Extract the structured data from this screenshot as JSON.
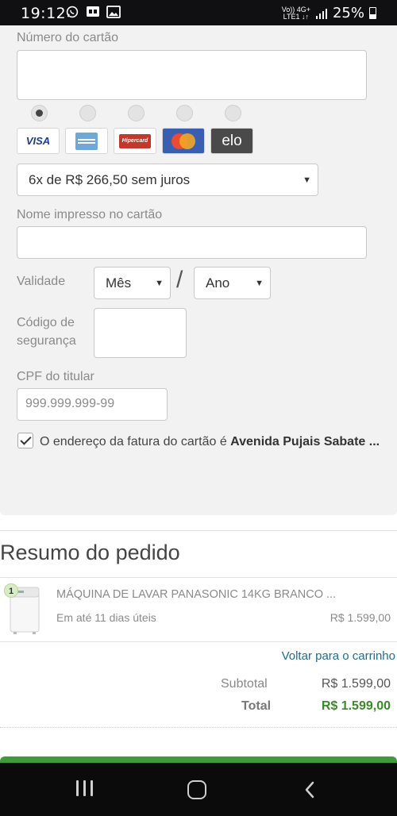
{
  "status_bar": {
    "time": "19:12",
    "network_top": "Vo)) 4G+",
    "network_bottom": "LTE1 ↓↑",
    "battery": "25%",
    "icons": [
      "whatsapp-icon",
      "gallery-icon",
      "image-icon",
      "signal-icon",
      "battery-icon"
    ]
  },
  "form": {
    "card_number_label": "Número do cartão",
    "card_number_value": "",
    "card_brands": [
      "VISA",
      "American Express",
      "Hipercard",
      "MasterCard",
      "elo"
    ],
    "selected_brand": "VISA",
    "installments": "6x de R$ 266,50 sem juros",
    "name_label": "Nome impresso no cartão",
    "name_value": "",
    "expiry_label": "Validade",
    "month_select": "Mês",
    "year_select": "Ano",
    "expiry_separator": "/",
    "cvv_label_line1": "Código de",
    "cvv_label_line2": "segurança",
    "cpf_label": "CPF do titular",
    "cpf_placeholder": "999.999.999-99",
    "billing_address_checked": true,
    "billing_address_prefix": "O endereço da fatura do cartão é ",
    "billing_address_bold": "Avenida Pujais Sabate ..."
  },
  "summary": {
    "title": "Resumo do pedido",
    "items": [
      {
        "quantity": "1",
        "name": "MÁQUINA DE LAVAR PANASONIC 14KG BRANCO ...",
        "shipping": "Em até 11 dias úteis",
        "price": "R$ 1.599,00"
      }
    ],
    "back_to_cart": "Voltar para o carrinho",
    "subtotal_label": "Subtotal",
    "subtotal_value": "R$ 1.599,00",
    "total_label": "Total",
    "total_value": "R$ 1.599,00"
  },
  "colors": {
    "accent_green": "#3a8a2a",
    "link_blue": "#1d6f8f",
    "form_bg": "#f2f2f2"
  }
}
